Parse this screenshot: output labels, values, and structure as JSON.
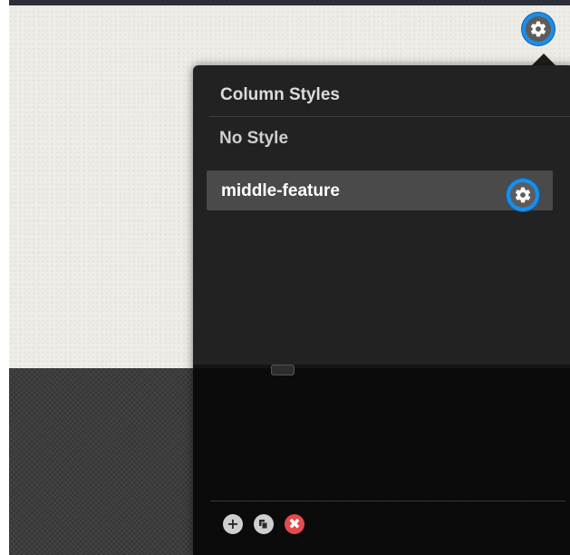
{
  "panel": {
    "title": "Column Styles",
    "options": [
      {
        "label": "No Style",
        "selected": false
      },
      {
        "label": "middle-feature",
        "selected": true
      }
    ]
  },
  "icons": {
    "top_settings": "gear-icon",
    "row_settings": "gear-icon",
    "add": "plus-icon",
    "copy": "copy-icon",
    "delete": "close-icon"
  },
  "colors": {
    "highlight_ring": "#1b8ee8",
    "delete": "#e54b4b",
    "selected_row": "#4a4a4a",
    "panel_bg": "#222222"
  }
}
